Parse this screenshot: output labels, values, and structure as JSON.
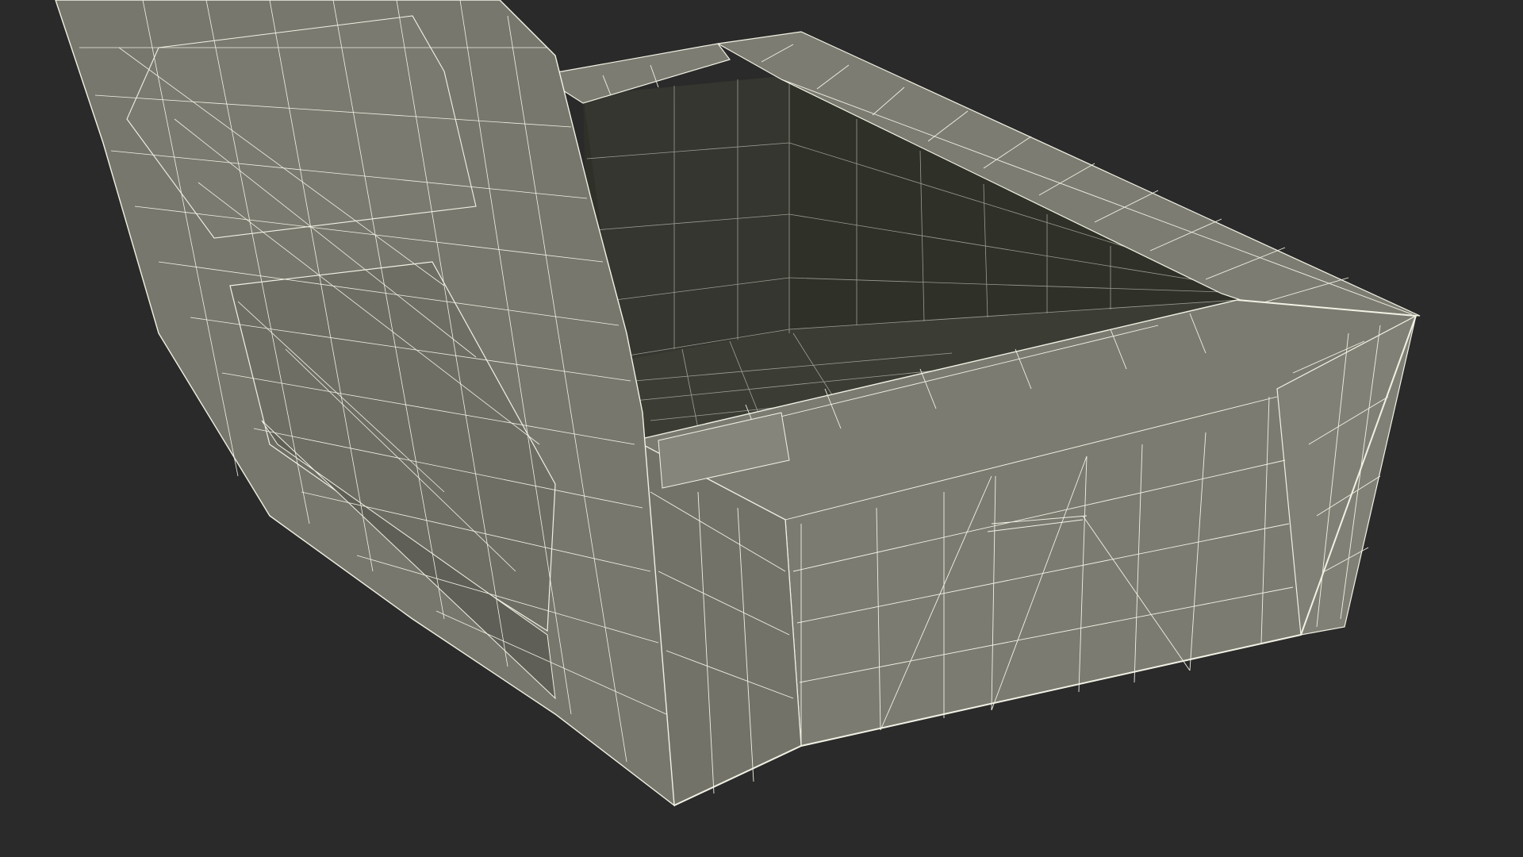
{
  "scene": {
    "background_color": "#2a2a2a",
    "surface_color": "#7c7c72",
    "surface_dark_color": "#6c6c63",
    "inner_color": "#2f3129",
    "inner_floor_color": "#3b3d35",
    "wire_color": "#f1f1e4",
    "subject_icon": "wireframe-box-model"
  }
}
